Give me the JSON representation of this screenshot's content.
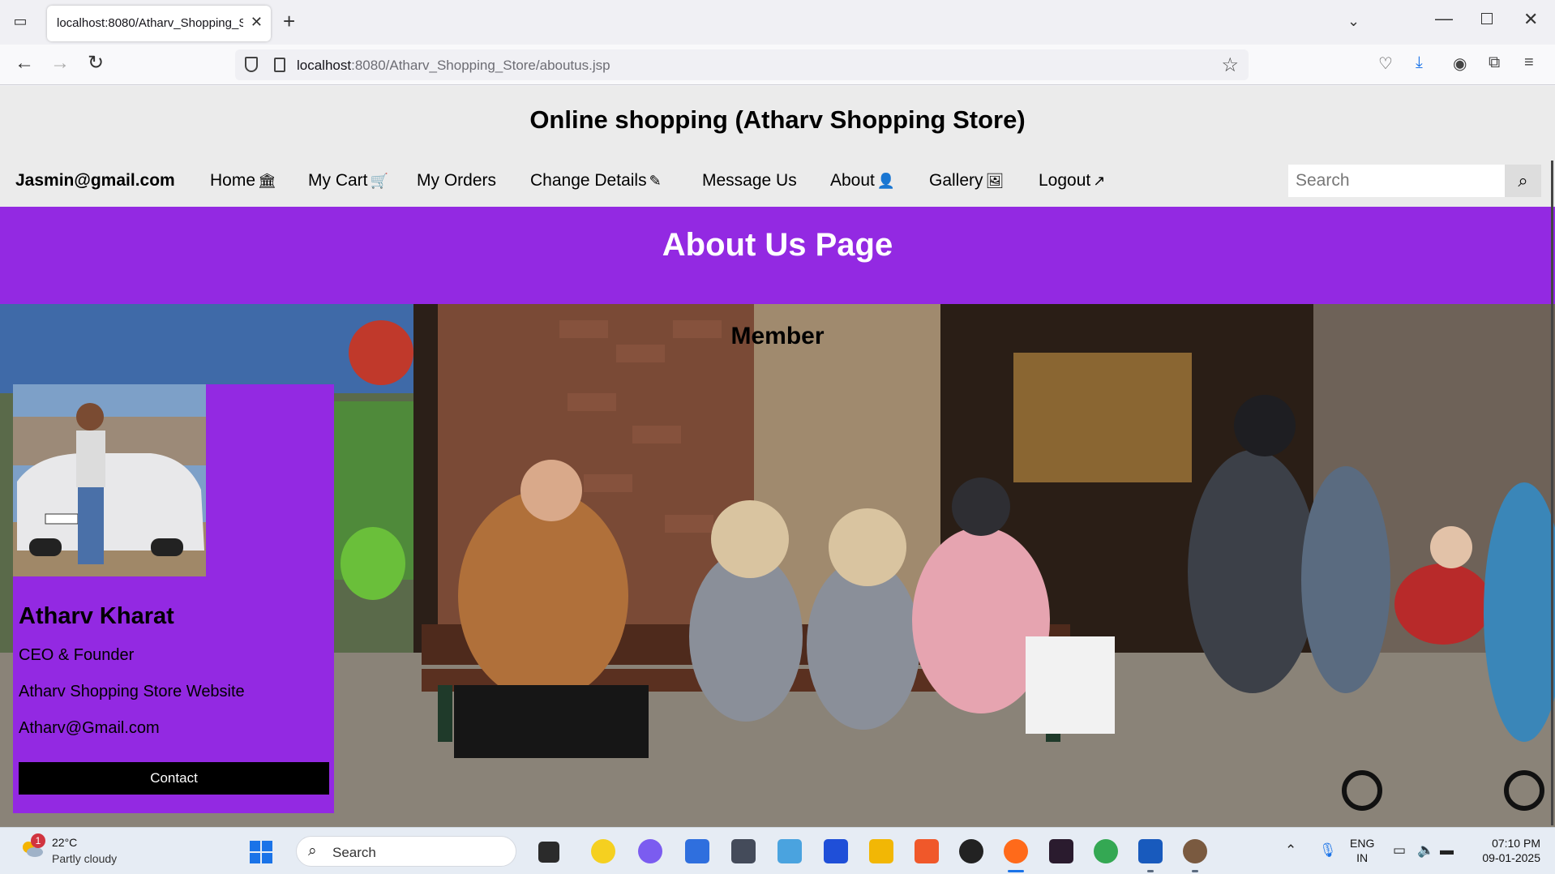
{
  "browser": {
    "tab_title": "localhost:8080/Atharv_Shopping_Store/aboutus.jsp",
    "url_host": "localhost",
    "url_path": ":8080/Atharv_Shopping_Store/aboutus.jsp"
  },
  "site": {
    "title": "Online shopping (Atharv Shopping Store)",
    "user_email": "Jasmin@gmail.com",
    "nav": [
      {
        "label": "Home",
        "icon": "bank-icon",
        "glyph": "🏛"
      },
      {
        "label": "My Cart",
        "icon": "cart-icon",
        "glyph": "🛒"
      },
      {
        "label": "My Orders"
      },
      {
        "label": "Change Details",
        "icon": "edit-icon",
        "glyph": "✎"
      },
      {
        "label": "Message Us"
      },
      {
        "label": "About",
        "icon": "address-book-icon",
        "glyph": "👤"
      },
      {
        "label": "Gallery",
        "icon": "image-icon",
        "glyph": "🖼"
      },
      {
        "label": "Logout",
        "icon": "share-icon",
        "glyph": "↗"
      }
    ],
    "search_placeholder": "Search",
    "hero_title": "About Us Page",
    "section_heading": "Member",
    "accent_color": "#9329e2"
  },
  "member": {
    "name": "Atharv Kharat",
    "role": "CEO & Founder",
    "company": "Atharv Shopping Store Website",
    "email": "Atharv@Gmail.com",
    "button_label": "Contact"
  },
  "taskbar": {
    "weather_temp": "22°C",
    "weather_desc": "Partly cloudy",
    "weather_badge": "1",
    "search_label": "Search",
    "lang_line1": "ENG",
    "lang_line2": "IN",
    "time": "07:10 PM",
    "date": "09-01-2025"
  }
}
